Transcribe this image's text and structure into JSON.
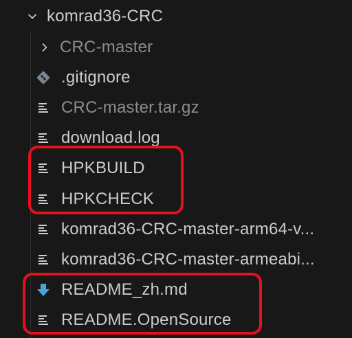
{
  "tree": {
    "root": {
      "label": "komrad36-CRC",
      "icon": "chevron-down-icon",
      "expanded": true
    },
    "items": [
      {
        "label": "CRC-master",
        "type": "folder",
        "icon": "chevron-right-icon",
        "dim": true
      },
      {
        "label": ".gitignore",
        "type": "git",
        "icon": "git-icon",
        "dim": false
      },
      {
        "label": "CRC-master.tar.gz",
        "type": "file",
        "icon": "file-lines-icon",
        "dim": true
      },
      {
        "label": "download.log",
        "type": "file",
        "icon": "file-lines-icon",
        "dim": false
      },
      {
        "label": "HPKBUILD",
        "type": "file",
        "icon": "file-lines-icon",
        "dim": false
      },
      {
        "label": "HPKCHECK",
        "type": "file",
        "icon": "file-lines-icon",
        "dim": false
      },
      {
        "label": "komrad36-CRC-master-arm64-v...",
        "type": "file",
        "icon": "file-lines-icon",
        "dim": false
      },
      {
        "label": "komrad36-CRC-master-armeabi...",
        "type": "file",
        "icon": "file-lines-icon",
        "dim": false
      },
      {
        "label": "README_zh.md",
        "type": "markdown",
        "icon": "markdown-download-icon",
        "dim": false
      },
      {
        "label": "README.OpenSource",
        "type": "file",
        "icon": "file-lines-icon",
        "dim": false
      }
    ]
  },
  "colors": {
    "background": "#181818",
    "text": "#cccccc",
    "text_dim": "#8c8c8c",
    "highlight": "#e8101c",
    "git_icon": "#7d8590",
    "markdown_icon": "#4aa3df"
  }
}
